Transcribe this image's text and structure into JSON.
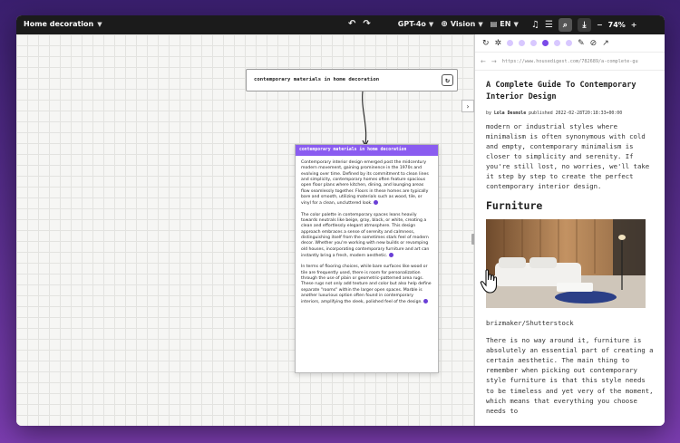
{
  "topbar": {
    "title": "Home decoration",
    "model": "GPT-4o",
    "vision": "Vision",
    "language": "EN",
    "zoom": "74%"
  },
  "prompt": {
    "text": "contemporary materials in home decoration"
  },
  "card": {
    "title": "contemporary materials in home decoration",
    "p1": "Contemporary interior design emerged post the midcentury modern movement, gaining prominence in the 1970s and evolving over time. Defined by its commitment to clean lines and simplicity, contemporary homes often feature spacious open floor plans where kitchen, dining, and lounging areas flow seamlessly together. Floors in these homes are typically bare and smooth, utilizing materials such as wood, tile, or vinyl for a clean, uncluttered look.",
    "p2": "The color palette in contemporary spaces leans heavily towards neutrals like beige, gray, black, or white, creating a clean and effortlessly elegant atmosphere. This design approach embraces a sense of serenity and calmness, distinguishing itself from the sometimes stark feel of modern decor. Whether you're working with new builds or revamping old houses, incorporating contemporary furniture and art can instantly bring a fresh, modern aesthetic.",
    "p3": "In terms of flooring choices, while bare surfaces like wood or tile are frequently used, there is room for personalization through the use of plain or geometric-patterned area rugs. These rugs not only add texture and color but also help define separate \"rooms\" within the larger open spaces. Marble is another luxurious option often found in contemporary interiors, amplifying the sleek, polished feel of the design."
  },
  "panel": {
    "url": "https://www.housedigest.com/782689/a-complete-gu",
    "article_title": "A Complete Guide To Contemporary Interior Design",
    "meta_by": "by",
    "meta_author": "Lola Desmole",
    "meta_published": "published 2022-02-28T20:18:33+00:00",
    "intro": "modern or industrial styles where minimalism is often synonymous with cold and empty, contemporary minimalism is closer to simplicity and serenity. If you're still lost, no worries, we'll take it step by step to create the perfect contemporary interior design.",
    "section_heading": "Furniture",
    "image_caption": "brizmaker/Shutterstock",
    "body": "There is no way around it, furniture is absolutely an essential part of creating a certain aesthetic. The main thing to remember when picking out contemporary style furniture is that this style needs to be timeless and yet very of the moment, which means that everything you choose needs to"
  },
  "colors": {
    "accent": "#8a5cf0",
    "topbar": "#1b1b1b",
    "citation": "#6a3fd6"
  }
}
